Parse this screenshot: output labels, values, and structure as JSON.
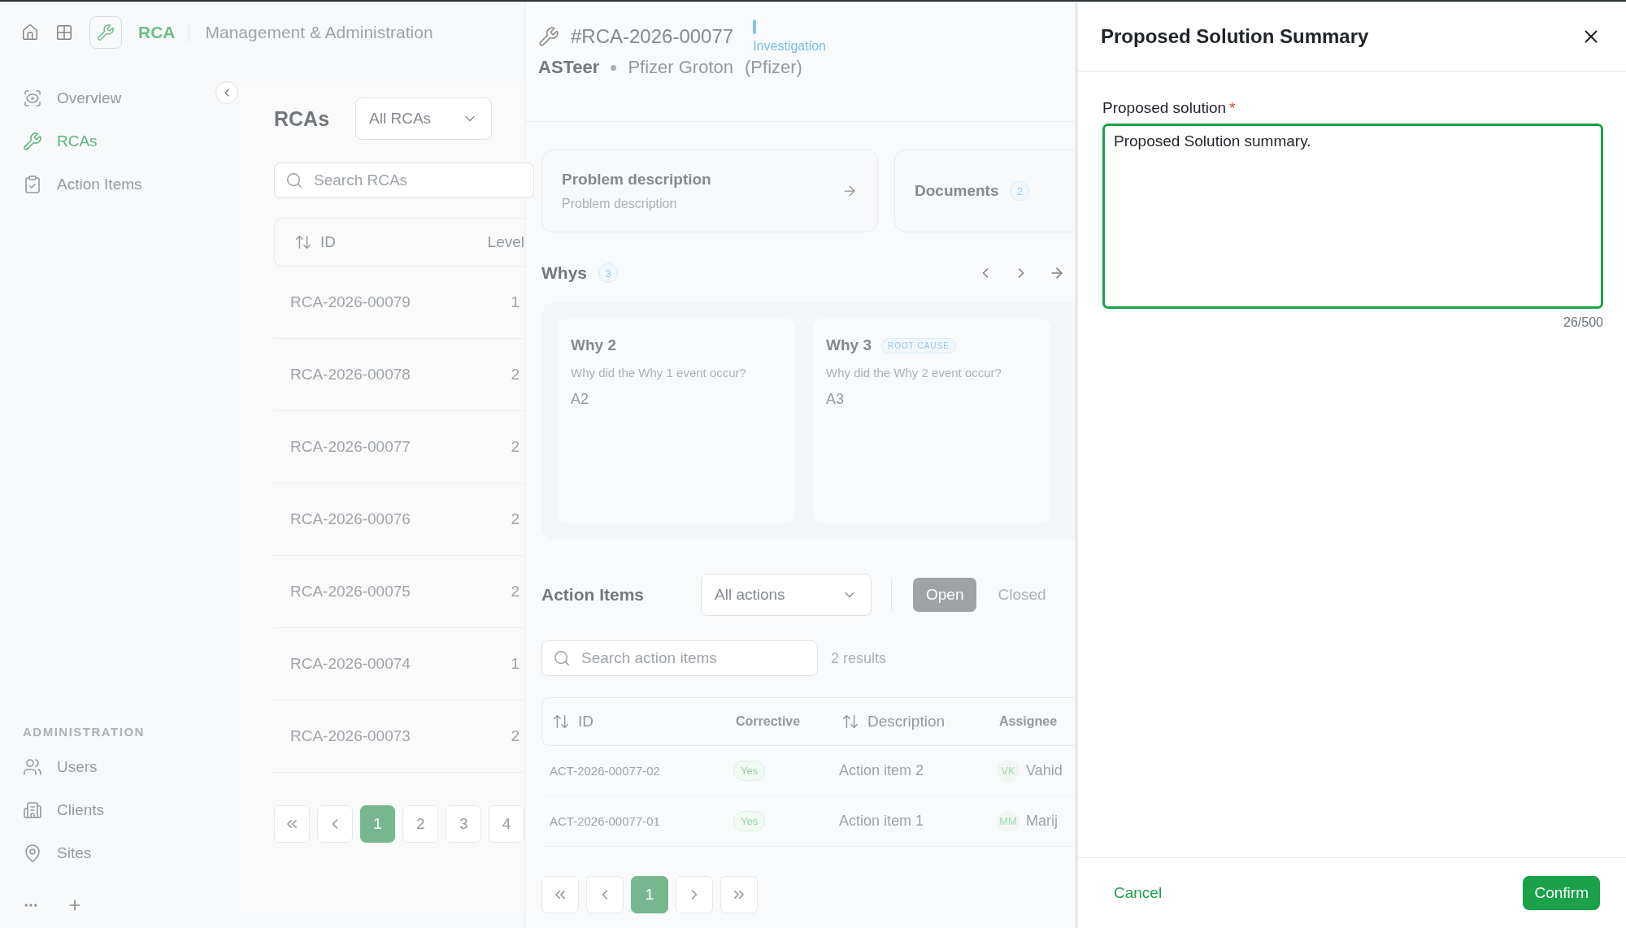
{
  "top_bar": {
    "app": "RCA",
    "subtitle": "Management & Administration"
  },
  "sidebar": {
    "items": [
      {
        "label": "Overview",
        "kind": "eye",
        "selected": false
      },
      {
        "label": "RCAs",
        "kind": "wrench",
        "selected": true
      },
      {
        "label": "Action Items",
        "kind": "clipboard",
        "selected": false
      }
    ],
    "section": "ADMINISTRATION",
    "admin_items": [
      {
        "label": "Users",
        "kind": "users",
        "selected": false
      },
      {
        "label": "Clients",
        "kind": "building",
        "selected": false
      },
      {
        "label": "Sites",
        "kind": "pin",
        "selected": false
      }
    ]
  },
  "rca_list": {
    "title": "RCAs",
    "filter": "All RCAs",
    "search_placeholder": "Search RCAs",
    "columns": [
      "ID",
      "Level"
    ],
    "rows": [
      {
        "id": "RCA-2026-00079",
        "level": "1"
      },
      {
        "id": "RCA-2026-00078",
        "level": "2"
      },
      {
        "id": "RCA-2026-00077",
        "level": "2"
      },
      {
        "id": "RCA-2026-00076",
        "level": "2"
      },
      {
        "id": "RCA-2026-00075",
        "level": "2"
      },
      {
        "id": "RCA-2026-00074",
        "level": "1"
      },
      {
        "id": "RCA-2026-00073",
        "level": "2"
      }
    ],
    "pages": [
      {
        "label": "1",
        "selected": true
      },
      {
        "label": "2",
        "selected": false
      },
      {
        "label": "3",
        "selected": false
      },
      {
        "label": "4",
        "selected": false
      }
    ]
  },
  "detail": {
    "id": "#RCA-2026-00077",
    "stage": "Investigation",
    "org": "ASTeer",
    "site": "Pfizer Groton",
    "client": "(Pfizer)",
    "problem": {
      "title": "Problem description",
      "subtitle": "Problem description"
    },
    "documents": {
      "label": "Documents",
      "count": "2"
    },
    "whys": {
      "title": "Whys",
      "count": "3",
      "items": [
        {
          "title": "Why 2",
          "question": "Why did the Why 1 event occur?",
          "answer": "A2"
        },
        {
          "title": "Why 3",
          "badge": "ROOT CAUSE",
          "question": "Why did the Why 2 event occur?",
          "answer": "A3"
        }
      ]
    },
    "action_items": {
      "title": "Action Items",
      "filter": "All actions",
      "segments": [
        {
          "label": "Open",
          "selected": true
        },
        {
          "label": "Closed",
          "selected": false
        }
      ],
      "search_placeholder": "Search action items",
      "results": "2 results",
      "columns": [
        {
          "label": "ID",
          "sortable": true
        },
        {
          "label": "Corrective",
          "sortable": false
        },
        {
          "label": "Description",
          "sortable": true
        },
        {
          "label": "Assignee",
          "sortable": false
        }
      ],
      "rows": [
        {
          "id": "ACT-2026-00077-02",
          "corrective": "Yes",
          "description": "Action item 2",
          "initials": "VK",
          "assignee": "Vahid"
        },
        {
          "id": "ACT-2026-00077-01",
          "corrective": "Yes",
          "description": "Action item 1",
          "initials": "MM",
          "assignee": "Marij"
        }
      ],
      "pages": [
        {
          "label": "1",
          "selected": true
        }
      ]
    }
  },
  "drawer": {
    "title": "Proposed Solution Summary",
    "field": {
      "label": "Proposed solution",
      "required_mark": "*",
      "value": "Proposed Solution summary.",
      "counter": "26/500"
    },
    "cancel": "Cancel",
    "confirm": "Confirm"
  }
}
